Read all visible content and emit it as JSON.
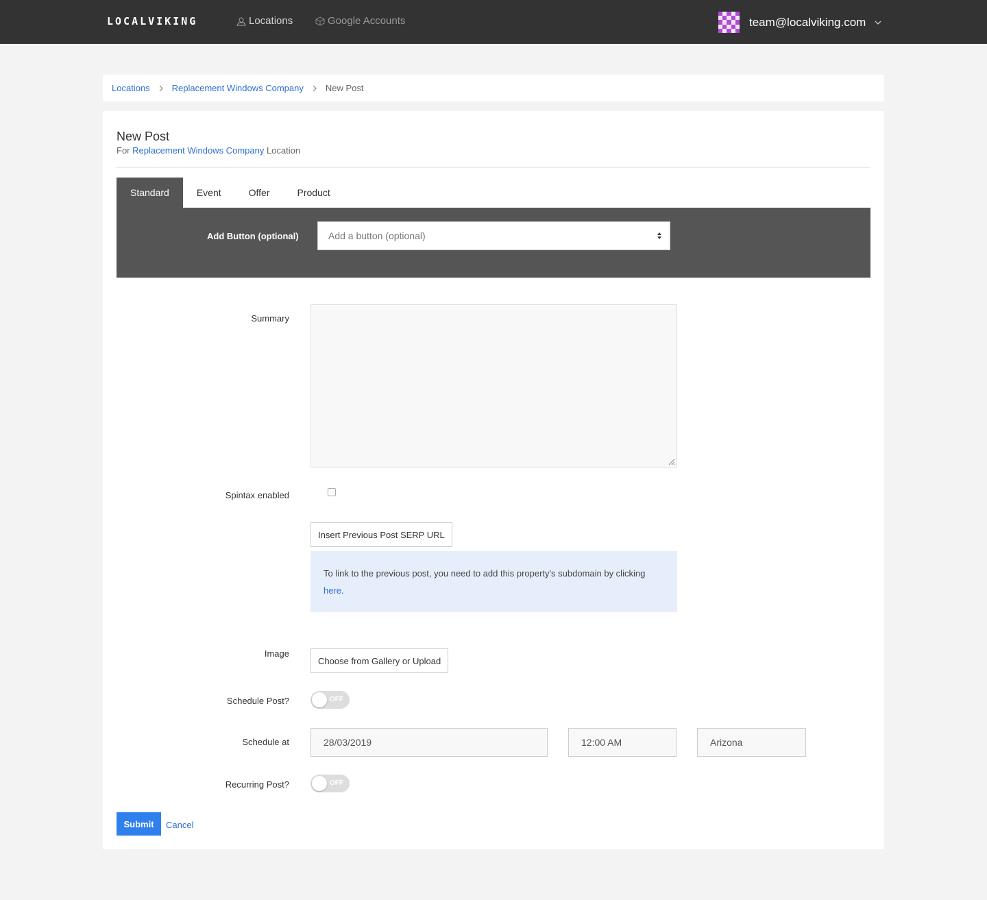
{
  "nav": {
    "logo": "LOCALVIKING",
    "locations": "Locations",
    "google_accounts": "Google Accounts",
    "user_email": "team@localviking.com",
    "icons": [
      "map-pin-icon",
      "cube-icon",
      "chevron-down-icon",
      "avatar-identicon"
    ]
  },
  "breadcrumb": {
    "items": [
      "Locations",
      "Replacement Windows Company"
    ],
    "current": "New Post"
  },
  "header": {
    "title": "New Post",
    "sub_prefix": "For",
    "sub_link": "Replacement Windows Company",
    "sub_suffix": "Location"
  },
  "tabs": [
    "Standard",
    "Event",
    "Offer",
    "Product"
  ],
  "active_tab": "Standard",
  "panel": {
    "button_label": "Add Button (optional)",
    "button_select_value": "Add a button (optional)"
  },
  "form": {
    "summary_label": "Summary",
    "summary_value": "",
    "spintax_label": "Spintax enabled",
    "spintax_checked": false,
    "serp_button": "Insert Previous Post SERP URL",
    "info_text": "To link to the previous post, you need to add this property's subdomain by clicking",
    "info_link": "here",
    "info_end": ".",
    "image_label": "Image",
    "gallery_button": "Choose from Gallery or Upload",
    "schedule_label": "Schedule Post?",
    "schedule_toggle": "OFF",
    "schedule_at_label": "Schedule at",
    "date_value": "28/03/2019",
    "time_value": "12:00 AM",
    "timezone_value": "Arizona",
    "recurring_label": "Recurring Post?",
    "recurring_toggle": "OFF"
  },
  "actions": {
    "submit": "Submit",
    "cancel": "Cancel"
  },
  "colors": {
    "nav_bg": "#333333",
    "tab_active_bg": "#555555",
    "link": "#2f6fd1",
    "primary": "#2f80ed",
    "info_bg": "#e6eefb"
  }
}
